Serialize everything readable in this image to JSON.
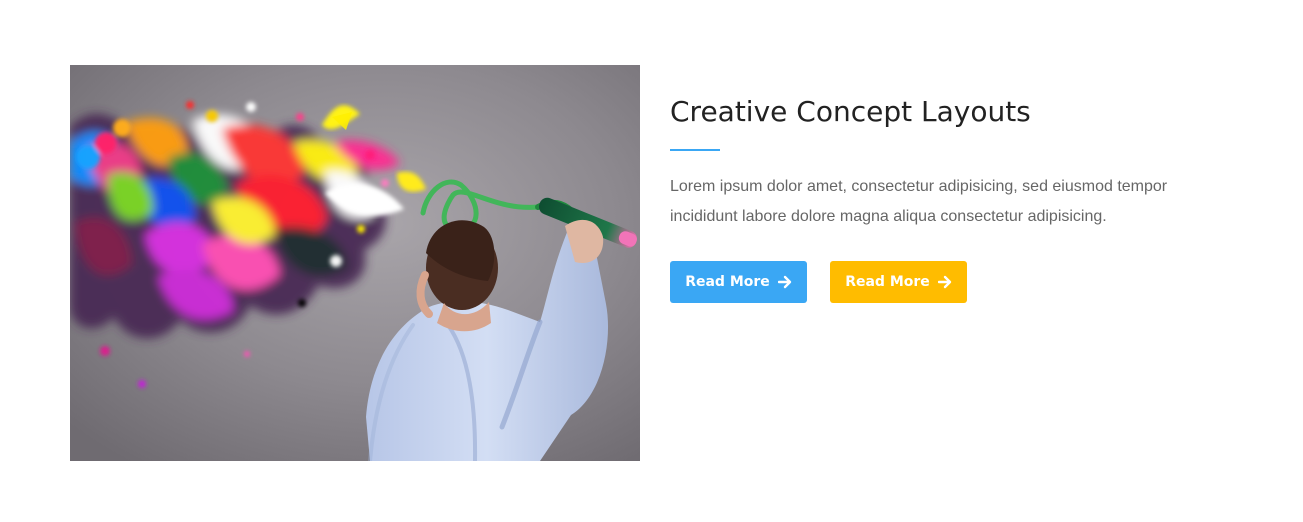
{
  "feature": {
    "title": "Creative Concept Layouts",
    "description": "Lorem ipsum dolor amet, consectetur adipisicing, sed eiusmod tempor incididunt labore dolore magna aliqua consectetur adipisicing.",
    "image_icon": "creative-paint-splash-image",
    "accent_color": "#3aa7f4",
    "buttons": [
      {
        "label": "Read More",
        "icon": "arrow-right-icon",
        "color": "#3aa7f4"
      },
      {
        "label": "Read More",
        "icon": "arrow-right-icon",
        "color": "#ffbc00"
      }
    ]
  }
}
